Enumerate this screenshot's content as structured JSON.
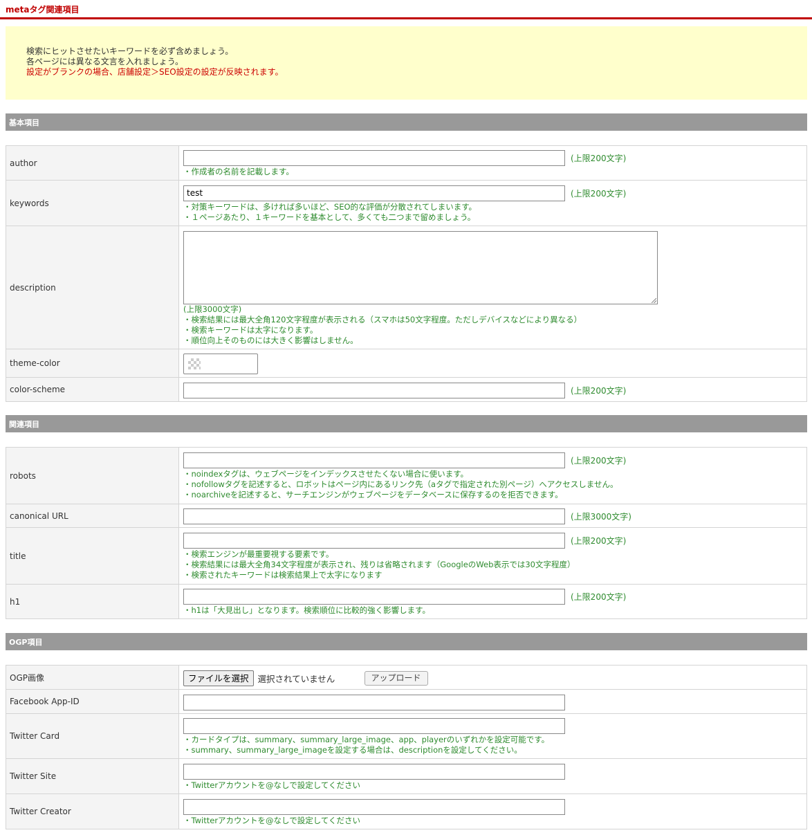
{
  "header": {
    "title": "metaタグ関連項目"
  },
  "notice": {
    "line1": "検索にヒットさせたいキーワードを必ず含めましょう。",
    "line2": "各ページには異なる文言を入れましょう。",
    "line3": "設定がブランクの場合、店舗設定＞SEO設定の設定が反映されます。"
  },
  "sections": {
    "basic": "基本項目",
    "related": "関連項目",
    "ogp": "OGP項目"
  },
  "basic": {
    "author": {
      "label": "author",
      "value": "",
      "limit": "(上限200文字)",
      "notes": [
        "・作成者の名前を記載します。"
      ]
    },
    "keywords": {
      "label": "keywords",
      "value": "test",
      "limit": "(上限200文字)",
      "notes": [
        "・対策キーワードは、多ければ多いほど、SEO的な評価が分散されてしまいます。",
        "・１ページあたり、１キーワードを基本として、多くても二つまで留めましょう。"
      ]
    },
    "description": {
      "label": "description",
      "value": "",
      "limit": "(上限3000文字)",
      "notes": [
        "・検索結果には最大全角120文字程度が表示される（スマホは50文字程度。ただしデバイスなどにより異なる）",
        "・検索キーワードは太字になります。",
        "・順位向上そのものには大きく影響はしません。"
      ]
    },
    "theme_color": {
      "label": "theme-color"
    },
    "color_scheme": {
      "label": "color-scheme",
      "value": "",
      "limit": "(上限200文字)"
    }
  },
  "related": {
    "robots": {
      "label": "robots",
      "value": "",
      "limit": "(上限200文字)",
      "notes": [
        "・noindexタグは、ウェブページをインデックスさせたくない場合に使います。",
        "・nofollowタグを記述すると、ロボットはページ内にあるリンク先（aタグで指定された別ページ）へアクセスしません。",
        "・noarchiveを記述すると、サーチエンジンがウェブページをデータベースに保存するのを拒否できます。"
      ]
    },
    "canonical": {
      "label": "canonical URL",
      "value": "",
      "limit": "(上限3000文字)"
    },
    "title": {
      "label": "title",
      "value": "",
      "limit": "(上限200文字)",
      "notes": [
        "・検索エンジンが最重要視する要素です。",
        "・検索結果には最大全角34文字程度が表示され、残りは省略されます（GoogleのWeb表示では30文字程度）",
        "・検索されたキーワードは検索結果上で太字になります"
      ]
    },
    "h1": {
      "label": "h1",
      "value": "",
      "limit": "(上限200文字)",
      "notes": [
        "・h1は「大見出し」となります。検索順位に比較的強く影響します。"
      ]
    }
  },
  "ogp": {
    "image": {
      "label": "OGP画像",
      "file_button": "ファイルを選択",
      "file_status": "選択されていません",
      "upload_button": "アップロード"
    },
    "facebook": {
      "label": "Facebook App-ID",
      "value": ""
    },
    "twitter_card": {
      "label": "Twitter Card",
      "value": "",
      "notes": [
        "・カードタイプは、summary、summary_large_image、app、playerのいずれかを設定可能です。",
        "・summary、summary_large_imageを設定する場合は、descriptionを設定してください。"
      ]
    },
    "twitter_site": {
      "label": "Twitter Site",
      "value": "",
      "notes": [
        "・Twitterアカウントを@なしで設定してください"
      ]
    },
    "twitter_creator": {
      "label": "Twitter Creator",
      "value": "",
      "notes": [
        "・Twitterアカウントを@なしで設定してください"
      ]
    }
  }
}
